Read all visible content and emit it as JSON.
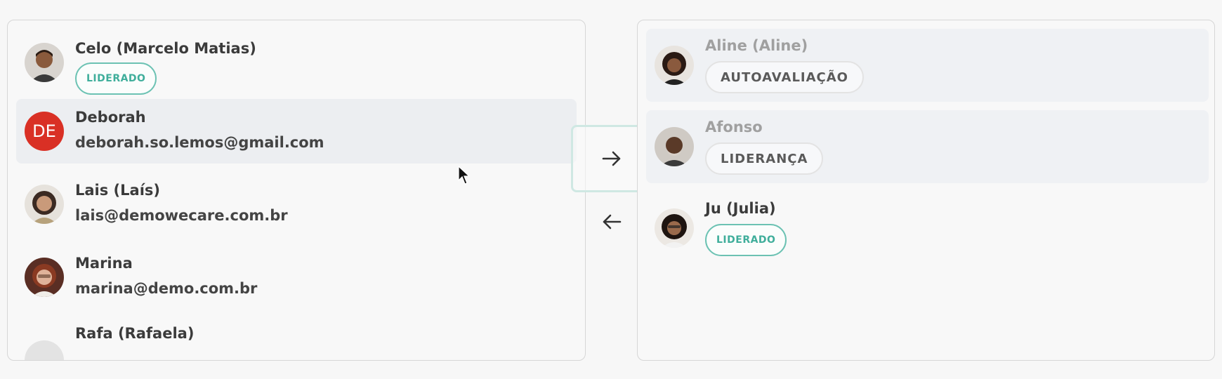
{
  "left_list": {
    "items": [
      {
        "name": "Celo (Marcelo Matias)",
        "badge": "LIDERADO"
      },
      {
        "name": "Deborah",
        "initials": "DE",
        "email": "deborah.so.lemos@gmail.com"
      },
      {
        "name": "Lais (Laís)",
        "email": "lais@demowecare.com.br"
      },
      {
        "name": "Marina",
        "email": "marina@demo.com.br"
      },
      {
        "name": "Rafa (Rafaela)"
      }
    ]
  },
  "right_list": {
    "items": [
      {
        "name": "Aline (Aline)",
        "badge": "AUTOAVALIAÇÃO"
      },
      {
        "name": "Afonso",
        "badge": "LIDERANÇA"
      },
      {
        "name": "Ju (Julia)",
        "badge": "LIDERADO"
      }
    ]
  },
  "icons": {
    "move_right": "arrow-right-icon",
    "move_left": "arrow-left-icon"
  },
  "colors": {
    "accent": "#3fae9b",
    "initials_avatar": "#d93025",
    "selected_row": "#eceef1"
  }
}
